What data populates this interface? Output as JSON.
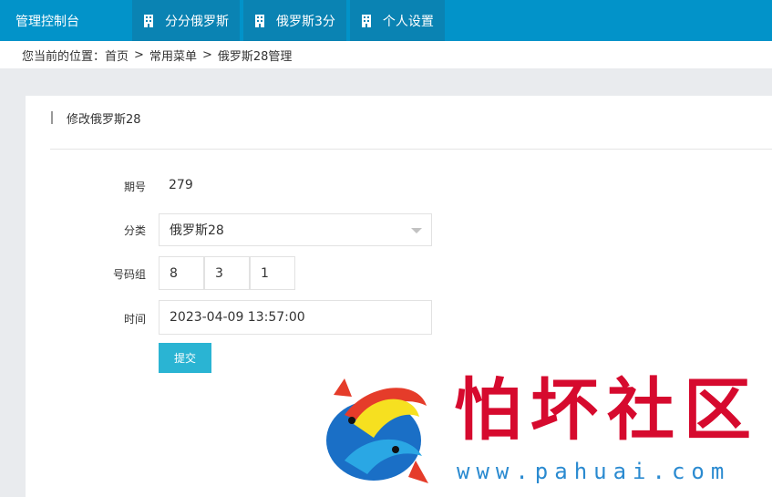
{
  "topbar": {
    "brand": "管理控制台",
    "tabs": [
      {
        "label": "分分俄罗斯",
        "icon": "building-icon"
      },
      {
        "label": "俄罗斯3分",
        "icon": "building-icon"
      },
      {
        "label": "个人设置",
        "icon": "building-icon"
      }
    ]
  },
  "breadcrumb": {
    "prefix": "您当前的位置：",
    "items": [
      "首页",
      "常用菜单",
      "俄罗斯28管理"
    ],
    "separator": ">"
  },
  "panel": {
    "title": "修改俄罗斯28"
  },
  "form": {
    "period_label": "期号",
    "period_value": "279",
    "category_label": "分类",
    "category_value": "俄罗斯28",
    "numbers_label": "号码组",
    "numbers": [
      "8",
      "3",
      "1"
    ],
    "time_label": "时间",
    "time_value": "2023-04-09 13:57:00",
    "submit_label": "提交"
  },
  "watermark": {
    "text": "怕坏社区",
    "url": "www.pahuai.com"
  },
  "colors": {
    "topbar": "#0293c9",
    "tab": "#0a83b3",
    "submit": "#2ab4d3",
    "watermark_text": "#d60a2e",
    "watermark_url": "#2a8ad0"
  }
}
